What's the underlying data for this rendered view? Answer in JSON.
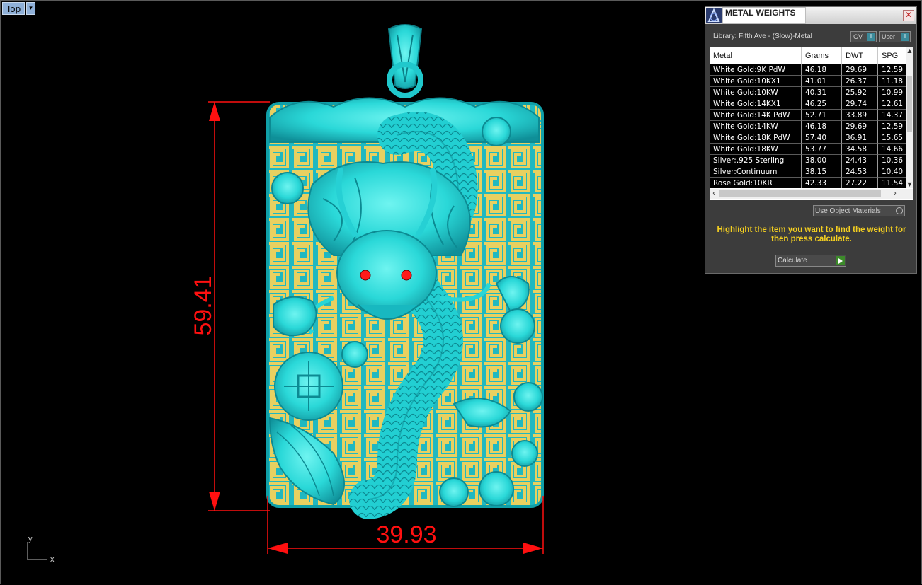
{
  "viewport": {
    "view_name": "Top",
    "dropdown_glyph": "▾",
    "axis_y": "y",
    "axis_x": "x",
    "dimension_height": "59.41",
    "dimension_width": "39.93",
    "colors": {
      "model": "#2ce0e0",
      "model_shade": "#0f8f98",
      "background_grid": "#e8d060",
      "dimension": "#ff1010",
      "eyes": "#ff1a1a"
    }
  },
  "panel": {
    "title": "METAL WEIGHTS",
    "close_glyph": "✕",
    "library_label": "Library: Fifth Ave - (Slow)-Metal",
    "gv_toggle": "GV",
    "user_toggle": "User",
    "toggle_knob": "I",
    "columns": [
      "Metal",
      "Grams",
      "DWT",
      "SPG"
    ],
    "rows": [
      {
        "metal": "White Gold:9K PdW",
        "grams": "46.18",
        "dwt": "29.69",
        "spg": "12.59"
      },
      {
        "metal": "White Gold:10KX1",
        "grams": "41.01",
        "dwt": "26.37",
        "spg": "11.18"
      },
      {
        "metal": "White Gold:10KW",
        "grams": "40.31",
        "dwt": "25.92",
        "spg": "10.99"
      },
      {
        "metal": "White Gold:14KX1",
        "grams": "46.25",
        "dwt": "29.74",
        "spg": "12.61"
      },
      {
        "metal": "White Gold:14K PdW",
        "grams": "52.71",
        "dwt": "33.89",
        "spg": "14.37"
      },
      {
        "metal": "White Gold:14KW",
        "grams": "46.18",
        "dwt": "29.69",
        "spg": "12.59"
      },
      {
        "metal": "White Gold:18K PdW",
        "grams": "57.40",
        "dwt": "36.91",
        "spg": "15.65"
      },
      {
        "metal": "White Gold:18KW",
        "grams": "53.77",
        "dwt": "34.58",
        "spg": "14.66"
      },
      {
        "metal": "Silver:.925 Sterling",
        "grams": "38.00",
        "dwt": "24.43",
        "spg": "10.36"
      },
      {
        "metal": "Silver:Continuum",
        "grams": "38.15",
        "dwt": "24.53",
        "spg": "10.40"
      },
      {
        "metal": "Rose Gold:10KR",
        "grams": "42.33",
        "dwt": "27.22",
        "spg": "11.54"
      }
    ],
    "use_object_materials": "Use Object Materials",
    "instruction": "Highlight the item you want to find the weight for then press calculate.",
    "calculate_label": "Calculate"
  }
}
